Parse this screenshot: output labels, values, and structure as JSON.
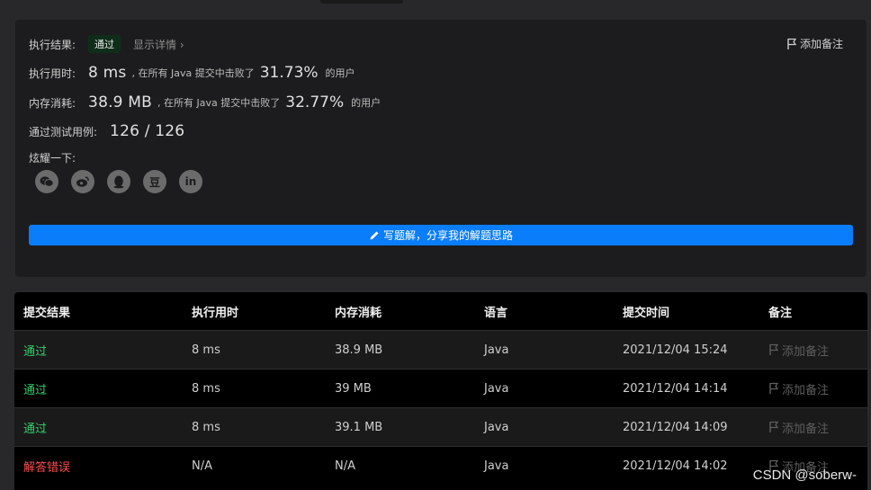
{
  "summary": {
    "result_label": "执行结果:",
    "result_badge": "通过",
    "show_details": "显示详情 ›",
    "add_note": "添加备注",
    "runtime_label": "执行用时:",
    "runtime_value": "8 ms",
    "beat_prefix": ", 在所有 Java 提交中击败了",
    "runtime_pct": "31.73%",
    "users_suffix": "的用户",
    "memory_label": "内存消耗:",
    "memory_value": "38.9 MB",
    "memory_pct": "32.77%",
    "tests_label": "通过测试用例:",
    "tests_value": "126 / 126",
    "share_label": "炫耀一下:",
    "write_button": "写题解，分享我的解题思路"
  },
  "socials": [
    {
      "name": "wechat-icon"
    },
    {
      "name": "weibo-icon"
    },
    {
      "name": "qq-icon"
    },
    {
      "name": "douban-icon",
      "glyph": "豆"
    },
    {
      "name": "linkedin-icon",
      "glyph": "in"
    }
  ],
  "table": {
    "headers": [
      "提交结果",
      "执行用时",
      "内存消耗",
      "语言",
      "提交时间",
      "备注"
    ],
    "rows": [
      {
        "status": "通过",
        "time": "8 ms",
        "memory": "38.9 MB",
        "lang": "Java",
        "submitted": "2021/12/04 15:24",
        "note": "添加备注"
      },
      {
        "status": "通过",
        "time": "8 ms",
        "memory": "39 MB",
        "lang": "Java",
        "submitted": "2021/12/04 14:14",
        "note": "添加备注"
      },
      {
        "status": "通过",
        "time": "8 ms",
        "memory": "39.1 MB",
        "lang": "Java",
        "submitted": "2021/12/04 14:09",
        "note": "添加备注"
      },
      {
        "status": "解答错误",
        "time": "N/A",
        "memory": "N/A",
        "lang": "Java",
        "submitted": "2021/12/04 14:02",
        "note": "添加备注"
      }
    ]
  },
  "watermark": "CSDN @soberw-",
  "colors": {
    "accent": "#0a7dfa",
    "ok": "#33cf6b",
    "error": "#ff4d4f"
  }
}
